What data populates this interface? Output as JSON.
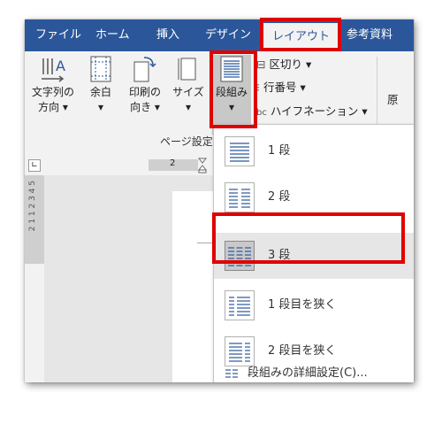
{
  "tabs": [
    "ファイル",
    "ホーム",
    "挿入",
    "デザイン",
    "レイアウト",
    "参考資料"
  ],
  "ribbon": {
    "text_direction": [
      "文字列の",
      "方向"
    ],
    "margins": "余白",
    "orientation": [
      "印刷の",
      "向き"
    ],
    "size": "サイズ",
    "columns": "段組み",
    "breaks": "区切り",
    "line_numbers": "行番号",
    "hyphenation": "ハイフネーション",
    "cut_label": "原",
    "group_page_setup": "ページ設定"
  },
  "ruler": {
    "tick_2": "2"
  },
  "vertical_ruler_text": "2  1  1  2  3  4  5",
  "columns_menu": {
    "items": [
      {
        "label": "1 段",
        "columns": 1
      },
      {
        "label": "2 段",
        "columns": 2
      },
      {
        "label": "3 段",
        "columns": 3
      },
      {
        "label": "1 段目を狭く",
        "columns": 2
      },
      {
        "label": "2 段目を狭く",
        "columns": 2
      }
    ],
    "more": "段組みの詳細設定(C)...",
    "selected_index": 2
  },
  "colors": {
    "ribbon_blue": "#2b579a",
    "highlight_red": "#e00000"
  }
}
